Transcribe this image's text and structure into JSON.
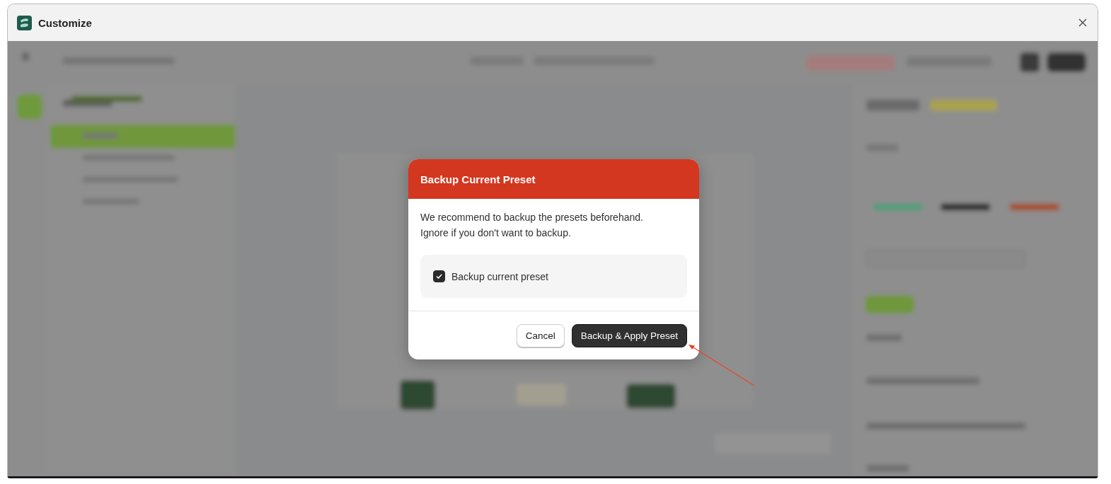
{
  "window": {
    "title": "Customize"
  },
  "dialog": {
    "title": "Backup Current Preset",
    "message": "We recommend to backup the presets beforehand. Ignore if you don't want to backup.",
    "checkbox": {
      "label": "Backup current preset",
      "checked": true
    },
    "buttons": [
      {
        "label": "Cancel",
        "kind": "secondary"
      },
      {
        "label": "Backup & Apply Preset",
        "kind": "primary"
      }
    ]
  }
}
